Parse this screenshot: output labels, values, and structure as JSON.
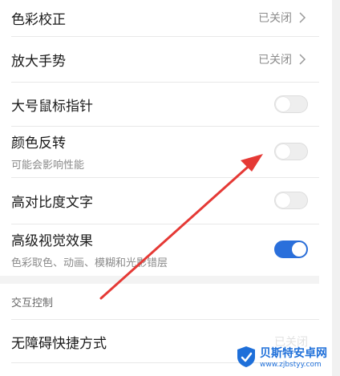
{
  "settings": {
    "items": [
      {
        "title": "色彩校正",
        "value": "已关闭"
      },
      {
        "title": "放大手势",
        "value": "已关闭"
      },
      {
        "title": "大号鼠标指针",
        "toggle": false
      },
      {
        "title": "颜色反转",
        "subtitle": "可能会影响性能",
        "toggle": false
      },
      {
        "title": "高对比度文字",
        "toggle": false
      },
      {
        "title": "高级视觉效果",
        "subtitle": "色彩取色、动画、模糊和光影错层",
        "toggle": true
      }
    ]
  },
  "section": {
    "header": "交互控制",
    "items": [
      {
        "title": "无障碍快捷方式",
        "value": "已关闭"
      }
    ]
  },
  "watermark": {
    "title": "贝斯特安卓网",
    "url": "www.zjbstyy.com"
  },
  "colors": {
    "accent": "#2a6fdb",
    "arrow": "#e53935",
    "watermark": "#1e6fd9"
  },
  "icons": [
    "chevron-right-icon",
    "shield-logo-icon"
  ]
}
